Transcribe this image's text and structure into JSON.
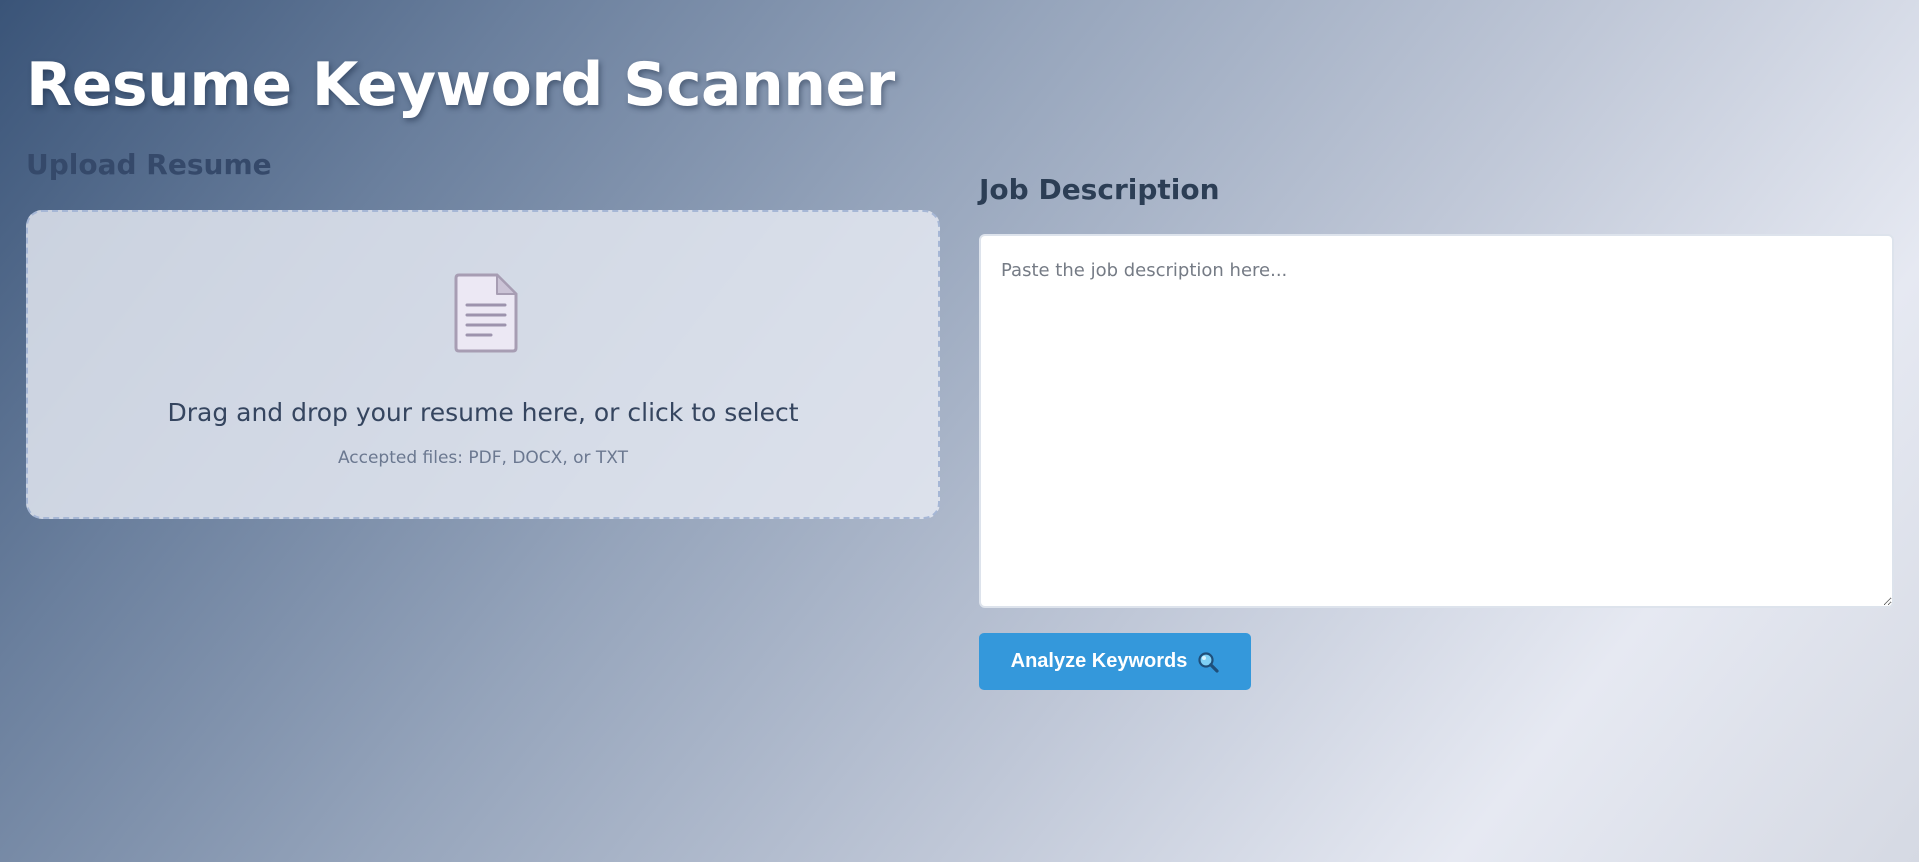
{
  "header": {
    "title": "Resume Keyword Scanner"
  },
  "upload": {
    "title": "Upload Resume",
    "drop_text": "Drag and drop your resume here, or click to select",
    "accepted_text": "Accepted files: PDF, DOCX, or TXT",
    "icon": "document-icon"
  },
  "job": {
    "title": "Job Description",
    "value": "",
    "placeholder": "Paste the job description here..."
  },
  "actions": {
    "analyze_label": "Analyze Keywords",
    "analyze_icon": "search-icon",
    "accent_color": "#3498db"
  }
}
